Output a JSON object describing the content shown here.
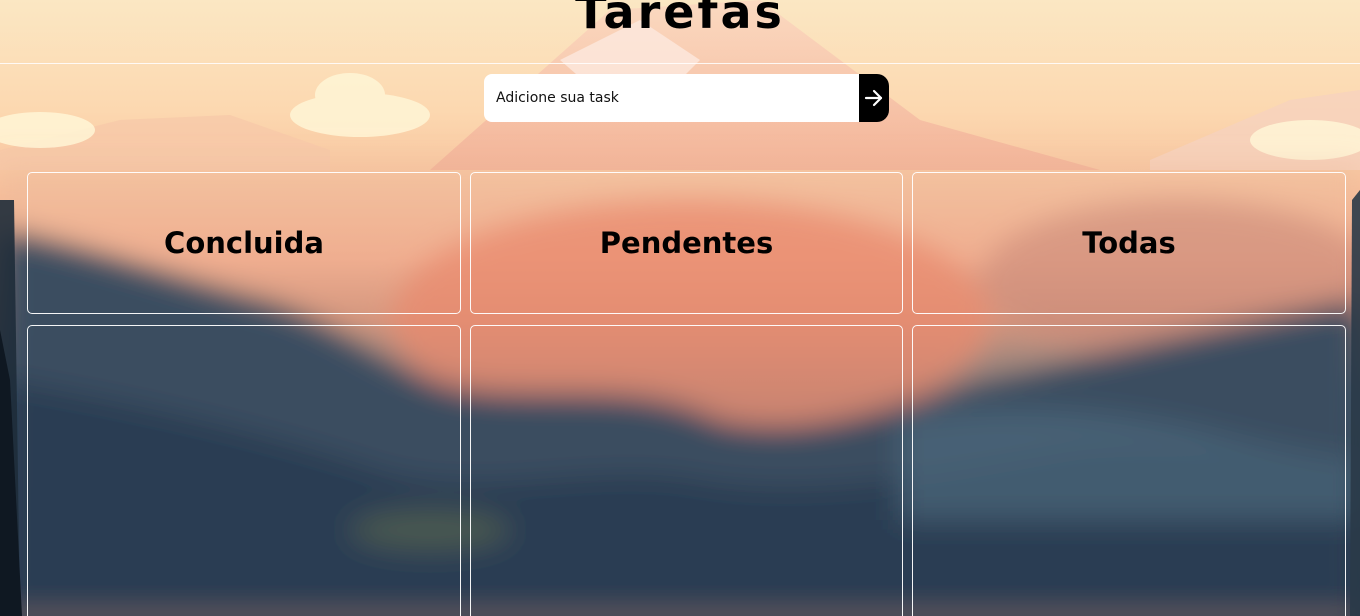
{
  "app": {
    "title": "Tarefas"
  },
  "form": {
    "placeholder": "Adicione sua task",
    "value": "",
    "submit_icon": "arrow-right-icon"
  },
  "columns": [
    {
      "label": "Concluida",
      "items": []
    },
    {
      "label": "Pendentes",
      "items": []
    },
    {
      "label": "Todas",
      "items": []
    }
  ],
  "colors": {
    "accent": "#000000",
    "panel_border": "#ffffff",
    "sky_top": "#fbe7c3",
    "sunset": "#f3a98a",
    "mountains": "#2f4558"
  }
}
